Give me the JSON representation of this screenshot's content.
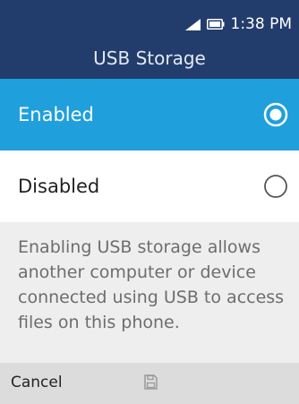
{
  "status_bar": {
    "time": "1:38 PM",
    "signal_icon": "signal-icon",
    "battery_icon": "battery-icon"
  },
  "header": {
    "title": "USB Storage"
  },
  "options": [
    {
      "label": "Enabled",
      "selected": true
    },
    {
      "label": "Disabled",
      "selected": false
    }
  ],
  "description": "Enabling USB storage allows another computer or device connected using USB to access files on this phone.",
  "softkeys": {
    "left_label": "Cancel",
    "center_icon": "save-icon"
  },
  "colors": {
    "header_bg": "#223d6c",
    "selected_bg": "#1f9fdc",
    "description_bg": "#eeeeee",
    "softkey_bg": "#dcdcdc"
  }
}
